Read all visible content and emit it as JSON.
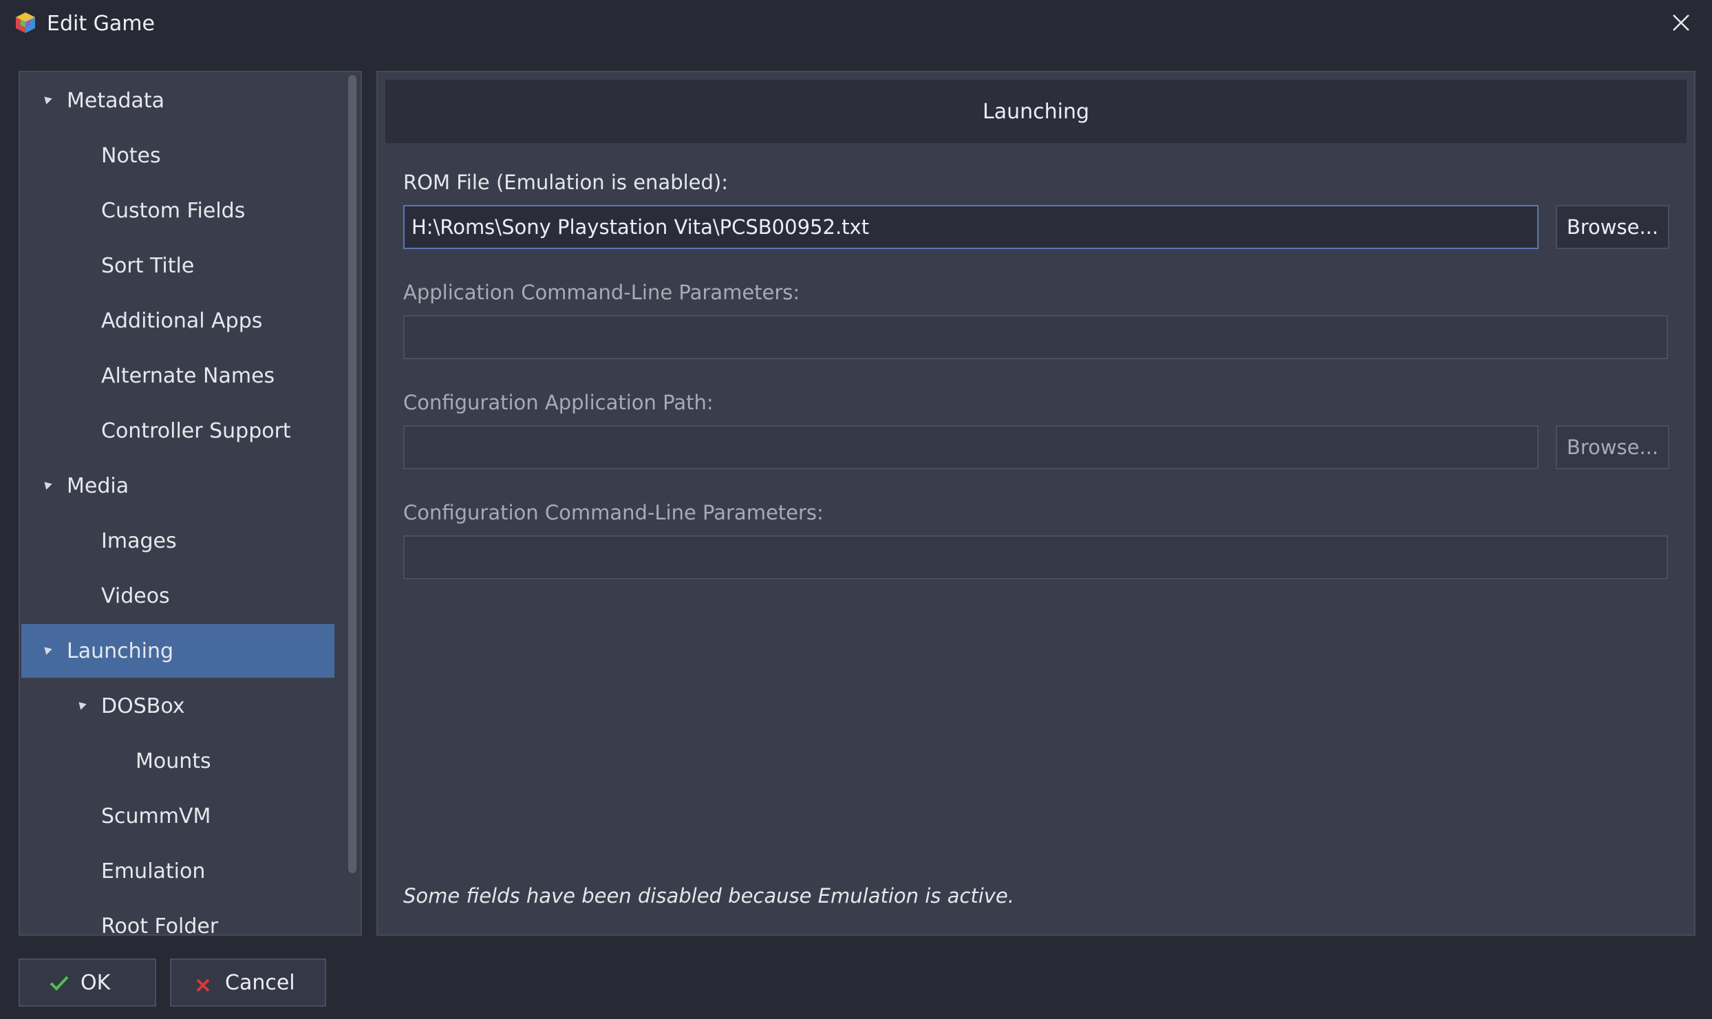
{
  "window": {
    "title": "Edit Game",
    "app_icon": "launchbox-cube-icon",
    "close_icon": "close-icon"
  },
  "sidebar": {
    "items": [
      {
        "label": "Metadata",
        "level": 0,
        "expanded": true
      },
      {
        "label": "Notes",
        "level": 1
      },
      {
        "label": "Custom Fields",
        "level": 1
      },
      {
        "label": "Sort Title",
        "level": 1
      },
      {
        "label": "Additional Apps",
        "level": 1
      },
      {
        "label": "Alternate Names",
        "level": 1
      },
      {
        "label": "Controller Support",
        "level": 1
      },
      {
        "label": "Media",
        "level": 0,
        "expanded": true
      },
      {
        "label": "Images",
        "level": 1
      },
      {
        "label": "Videos",
        "level": 1
      },
      {
        "label": "Launching",
        "level": 0,
        "expanded": true,
        "selected": true
      },
      {
        "label": "DOSBox",
        "level": 1,
        "expanded": true
      },
      {
        "label": "Mounts",
        "level": 2
      },
      {
        "label": "ScummVM",
        "level": 1
      },
      {
        "label": "Emulation",
        "level": 1
      },
      {
        "label": "Root Folder",
        "level": 1
      }
    ]
  },
  "main": {
    "header": "Launching",
    "rom_file": {
      "label": "ROM File (Emulation is enabled):",
      "value": "H:\\Roms\\Sony Playstation Vita\\PCSB00952.txt",
      "browse_label": "Browse..."
    },
    "app_params": {
      "label": "Application Command-Line Parameters:",
      "value": ""
    },
    "config_path": {
      "label": "Configuration Application Path:",
      "value": "",
      "browse_label": "Browse..."
    },
    "config_params": {
      "label": "Configuration Command-Line Parameters:",
      "value": ""
    },
    "note": "Some fields have been disabled because Emulation is active."
  },
  "buttons": {
    "ok_label": "OK",
    "ok_icon": "checkmark-icon",
    "cancel_label": "Cancel",
    "cancel_icon": "x-mark-icon"
  },
  "colors": {
    "background": "#272a35",
    "panel": "#3a3d4b",
    "selected": "#466a9e",
    "ok_check": "#4cc24f",
    "cancel_x": "#d83a3a"
  }
}
